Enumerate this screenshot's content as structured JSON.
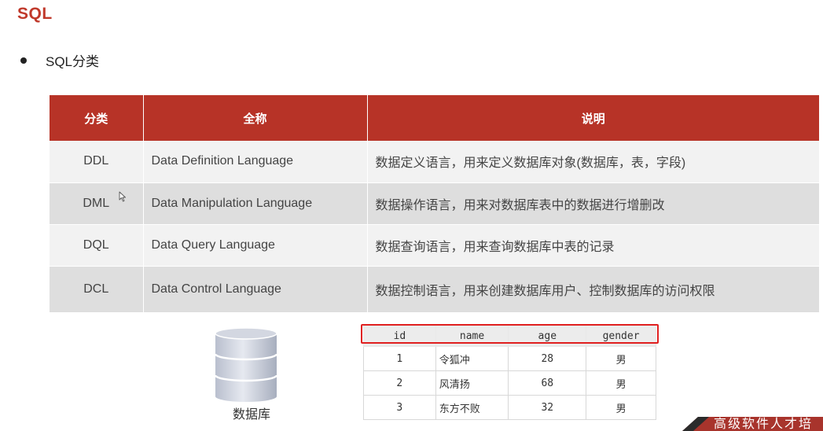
{
  "title": "SQL",
  "bullet": "SQL分类",
  "table": {
    "headers": [
      "分类",
      "全称",
      "说明"
    ],
    "rows": [
      {
        "abbr": "DDL",
        "full": "Data Definition Language",
        "desc": "数据定义语言，用来定义数据库对象(数据库，表，字段)"
      },
      {
        "abbr": "DML",
        "full": "Data Manipulation Language",
        "desc": "数据操作语言，用来对数据库表中的数据进行增删改"
      },
      {
        "abbr": "DQL",
        "full": "Data Query Language",
        "desc": "数据查询语言，用来查询数据库中表的记录"
      },
      {
        "abbr": "DCL",
        "full": "Data Control Language",
        "desc": "数据控制语言，用来创建数据库用户、控制数据库的访问权限"
      }
    ]
  },
  "database": {
    "label": "数据库",
    "icon": "database-icon"
  },
  "sample": {
    "headers": [
      "id",
      "name",
      "age",
      "gender"
    ],
    "rows": [
      {
        "id": "1",
        "name": "令狐冲",
        "age": "28",
        "gender": "男"
      },
      {
        "id": "2",
        "name": "风清扬",
        "age": "68",
        "gender": "男"
      },
      {
        "id": "3",
        "name": "东方不败",
        "age": "32",
        "gender": "男"
      }
    ]
  },
  "watermark": "高级软件人才培",
  "colors": {
    "accent": "#b73327",
    "title": "#c0392b",
    "highlight": "#e02020"
  }
}
